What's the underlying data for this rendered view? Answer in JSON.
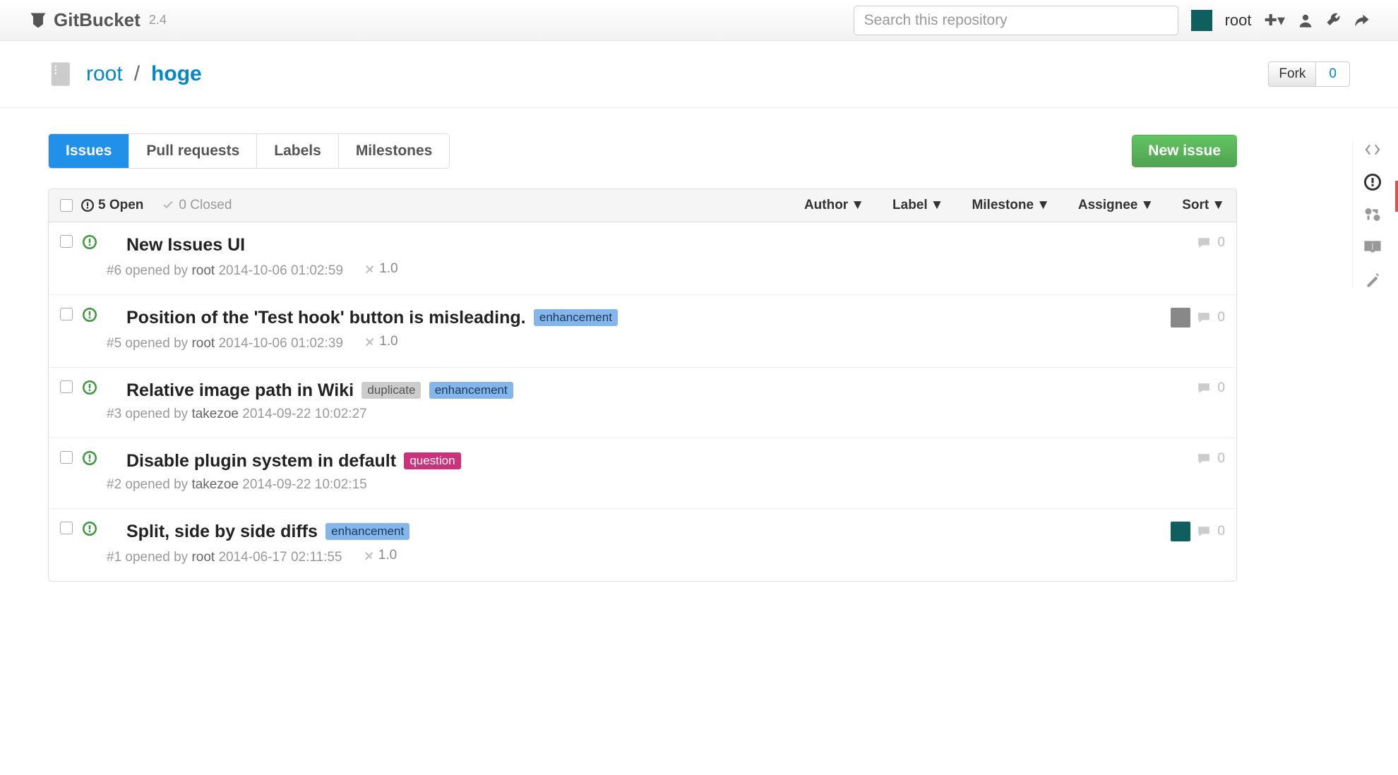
{
  "brand": {
    "name": "GitBucket",
    "version": "2.4"
  },
  "search": {
    "placeholder": "Search this repository"
  },
  "user": {
    "name": "root"
  },
  "repo": {
    "owner": "root",
    "name": "hoge",
    "fork_label": "Fork",
    "fork_count": "0"
  },
  "tabs": {
    "issues": "Issues",
    "pulls": "Pull requests",
    "labels": "Labels",
    "milestones": "Milestones"
  },
  "new_issue": "New issue",
  "toolbar": {
    "open_count": "5 Open",
    "closed_count": "0 Closed",
    "filters": {
      "author": "Author",
      "label": "Label",
      "milestone": "Milestone",
      "assignee": "Assignee",
      "sort": "Sort"
    }
  },
  "issues": [
    {
      "title": "New Issues UI",
      "number": "#6",
      "opened_by": "root",
      "timestamp": "2014-10-06 01:02:59",
      "milestone": "1.0",
      "labels": [],
      "comments": "0",
      "assignee": null
    },
    {
      "title": "Position of the 'Test hook' button is misleading.",
      "number": "#5",
      "opened_by": "root",
      "timestamp": "2014-10-06 01:02:39",
      "milestone": "1.0",
      "labels": [
        {
          "text": "enhancement",
          "cls": "lbl-enhancement"
        }
      ],
      "comments": "0",
      "assignee": "photo"
    },
    {
      "title": "Relative image path in Wiki",
      "number": "#3",
      "opened_by": "takezoe",
      "timestamp": "2014-09-22 10:02:27",
      "milestone": null,
      "labels": [
        {
          "text": "duplicate",
          "cls": "lbl-duplicate"
        },
        {
          "text": "enhancement",
          "cls": "lbl-enhancement"
        }
      ],
      "comments": "0",
      "assignee": null
    },
    {
      "title": "Disable plugin system in default",
      "number": "#2",
      "opened_by": "takezoe",
      "timestamp": "2014-09-22 10:02:15",
      "milestone": null,
      "labels": [
        {
          "text": "question",
          "cls": "lbl-question"
        }
      ],
      "comments": "0",
      "assignee": null
    },
    {
      "title": "Split, side by side diffs",
      "number": "#1",
      "opened_by": "root",
      "timestamp": "2014-06-17 02:11:55",
      "milestone": "1.0",
      "labels": [
        {
          "text": "enhancement",
          "cls": "lbl-enhancement"
        }
      ],
      "comments": "0",
      "assignee": "teal"
    }
  ],
  "meta_strings": {
    "opened_by": " opened by "
  }
}
